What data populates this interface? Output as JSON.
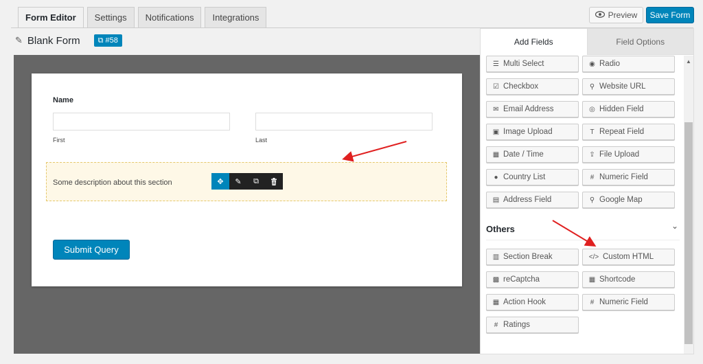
{
  "tabs": [
    {
      "label": "Form Editor"
    },
    {
      "label": "Settings"
    },
    {
      "label": "Notifications"
    },
    {
      "label": "Integrations"
    }
  ],
  "header": {
    "preview_label": "Preview",
    "save_label": "Save Form",
    "form_title": "Blank Form",
    "form_id": "#58"
  },
  "form": {
    "name_label": "Name",
    "first_label": "First",
    "last_label": "Last",
    "section_description": "Some description about this section",
    "submit_label": "Submit Query"
  },
  "panel": {
    "tab_add": "Add Fields",
    "tab_options": "Field Options",
    "fields": [
      {
        "label": "Multi Select",
        "icon": "list-icon"
      },
      {
        "label": "Radio",
        "icon": "radio-icon"
      },
      {
        "label": "Checkbox",
        "icon": "checkbox-icon"
      },
      {
        "label": "Website URL",
        "icon": "link-icon"
      },
      {
        "label": "Email Address",
        "icon": "envelope-icon"
      },
      {
        "label": "Hidden Field",
        "icon": "eye-slash-icon"
      },
      {
        "label": "Image Upload",
        "icon": "image-icon"
      },
      {
        "label": "Repeat Field",
        "icon": "text-icon"
      },
      {
        "label": "Date / Time",
        "icon": "calendar-icon"
      },
      {
        "label": "File Upload",
        "icon": "upload-icon"
      },
      {
        "label": "Country List",
        "icon": "globe-icon"
      },
      {
        "label": "Numeric Field",
        "icon": "hash-icon"
      },
      {
        "label": "Address Field",
        "icon": "address-card-icon"
      },
      {
        "label": "Google Map",
        "icon": "map-marker-icon"
      }
    ],
    "others_title": "Others",
    "others": [
      {
        "label": "Section Break",
        "icon": "columns-icon"
      },
      {
        "label": "Custom HTML",
        "icon": "code-icon"
      },
      {
        "label": "reCaptcha",
        "icon": "qrcode-icon"
      },
      {
        "label": "Shortcode",
        "icon": "calendar-icon"
      },
      {
        "label": "Action Hook",
        "icon": "calendar-icon"
      },
      {
        "label": "Numeric Field",
        "icon": "hash-icon"
      },
      {
        "label": "Ratings",
        "icon": "hash-icon"
      }
    ]
  },
  "colors": {
    "accent": "#0085ba",
    "annotation_arrow": "#e02020",
    "section_bg": "#fef8e7"
  }
}
